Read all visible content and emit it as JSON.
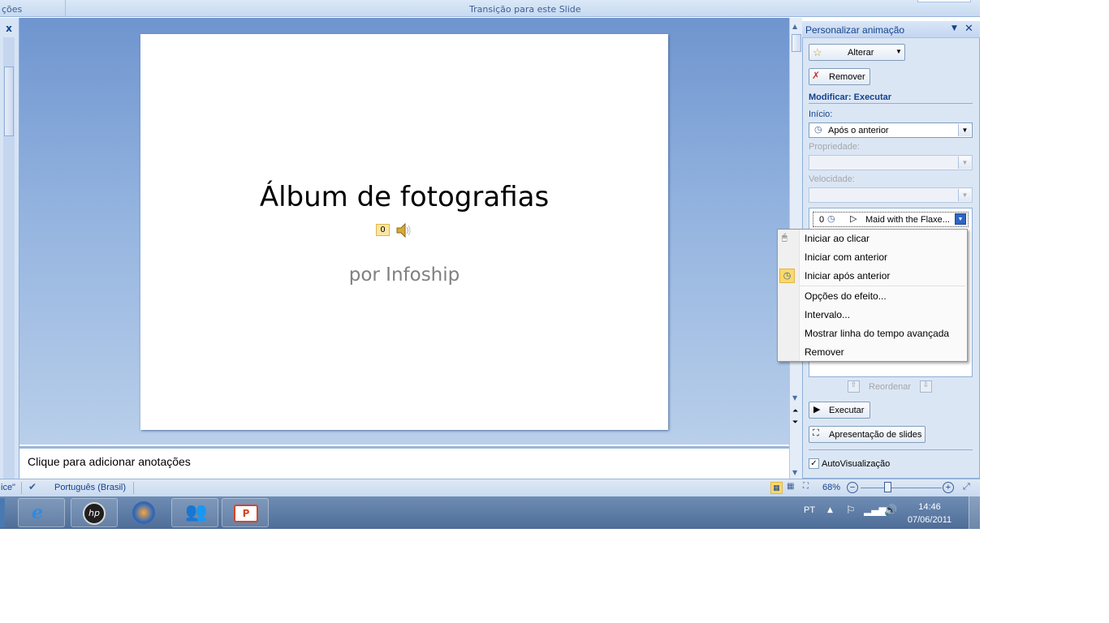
{
  "ribbon": {
    "left_group_label": "ções",
    "transition_group_label": "Transição para este Slide"
  },
  "slide": {
    "title": "Álbum de fotografias",
    "subtitle": "por Infoship",
    "badge": "0"
  },
  "notes": {
    "placeholder": "Clique para adicionar anotações"
  },
  "task_pane": {
    "title": "Personalizar animação",
    "change_button": "Alterar",
    "remove_button": "Remover",
    "modify_heading": "Modificar: Executar",
    "start_label": "Início:",
    "start_value": "Após o anterior",
    "property_label": "Propriedade:",
    "speed_label": "Velocidade:",
    "animation_item": {
      "index": "0",
      "name": "Maid with the Flaxe..."
    },
    "reorder_label": "Reordenar",
    "play_button": "Executar",
    "slideshow_button": "Apresentação de slides",
    "autopreview_label": "AutoVisualização",
    "autopreview_checked": true
  },
  "context_menu": {
    "items": [
      {
        "label": "Iniciar ao clicar",
        "icon": "mouse-icon"
      },
      {
        "label": "Iniciar com anterior",
        "icon": ""
      },
      {
        "label": "Iniciar após anterior",
        "icon": "clock-icon",
        "checked": true
      },
      {
        "label": "Opções do efeito...",
        "icon": ""
      },
      {
        "label": "Intervalo...",
        "icon": ""
      },
      {
        "label": "Mostrar linha do tempo avançada",
        "icon": ""
      },
      {
        "label": "Remover",
        "icon": ""
      }
    ]
  },
  "status_bar": {
    "theme_text": "ice\"",
    "language": "Português (Brasil)",
    "zoom": "68%"
  },
  "taskbar": {
    "language": "PT",
    "time": "14:46",
    "date": "07/06/2011"
  },
  "colors": {
    "accent": "#15428b",
    "slide_area_top": "#6f95cf",
    "menu_highlight": "#fbd96b"
  }
}
